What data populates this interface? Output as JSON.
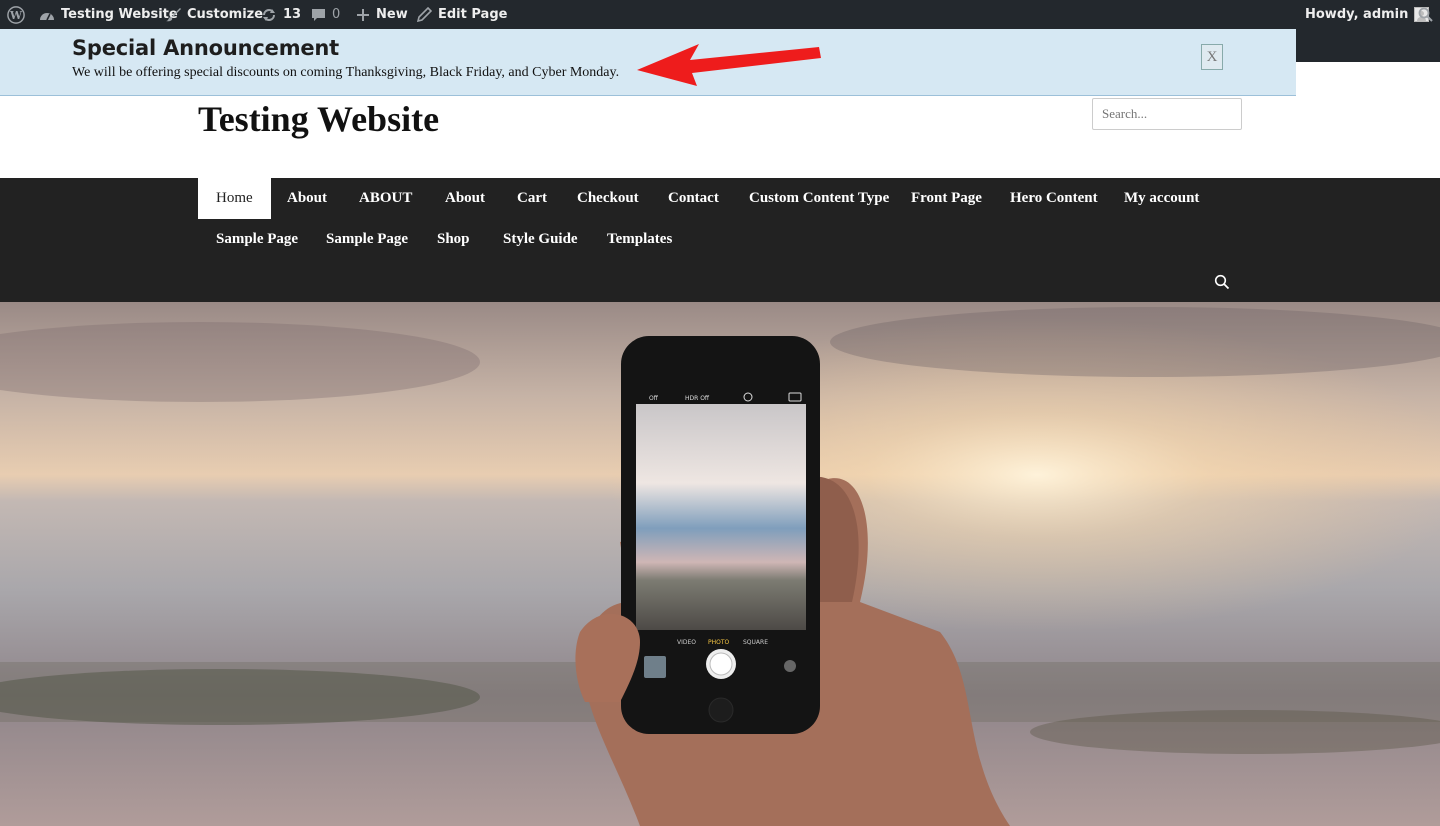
{
  "adminbar": {
    "site_name": "Testing Website",
    "customize": "Customize",
    "updates_count": "13",
    "comments_count": "0",
    "new_label": "New",
    "edit_page": "Edit Page",
    "howdy": "Howdy, admin"
  },
  "announcement": {
    "title": "Special Announcement",
    "text": "We will be offering special discounts on coming Thanksgiving, Black Friday, and Cyber Monday.",
    "close_label": "X"
  },
  "header": {
    "site_title": "Testing Website",
    "search_placeholder": "Search..."
  },
  "nav": {
    "row1": [
      "Home",
      "About",
      "ABOUT",
      "About",
      "Cart",
      "Checkout",
      "Contact",
      "Custom Content Type",
      "Front Page",
      "Hero Content",
      "My account"
    ],
    "row2": [
      "Sample Page",
      "Sample Page",
      "Shop",
      "Style Guide",
      "Templates"
    ]
  },
  "hero": {
    "camera_modes": [
      "VIDEO",
      "PHOTO",
      "SQUARE"
    ],
    "flash": "Off",
    "hdr": "HDR Off"
  },
  "colors": {
    "admin_bar": "#23282d",
    "announcement_bg": "#d6e8f3",
    "nav_bg": "#222222",
    "arrow": "#ee1c1c"
  }
}
